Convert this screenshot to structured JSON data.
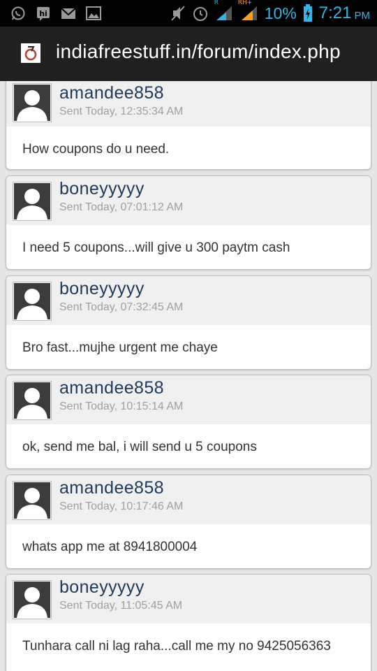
{
  "status_bar": {
    "battery_percent": "10%",
    "time": "7:21",
    "ampm": "PM",
    "signal_labels": {
      "r": "R",
      "rh": "RH+"
    },
    "accent_color": "#33b5e5"
  },
  "browser": {
    "url": "indiafreestuff.in/forum/index.php"
  },
  "messages": [
    {
      "username": "amandee858",
      "sent": "Sent Today, 12:35:34 AM",
      "text": "How coupons do u need."
    },
    {
      "username": "boneyyyyy",
      "sent": "Sent Today, 07:01:12 AM",
      "text": "I need 5 coupons...will give u 300 paytm cash"
    },
    {
      "username": "boneyyyyy",
      "sent": "Sent Today, 07:32:45 AM",
      "text": "Bro fast...mujhe urgent me chaye"
    },
    {
      "username": "amandee858",
      "sent": "Sent Today, 10:15:14 AM",
      "text": "ok, send me bal, i will send u 5 coupons"
    },
    {
      "username": "amandee858",
      "sent": "Sent Today, 10:17:46 AM",
      "text": "whats app me at 8941800004"
    },
    {
      "username": "boneyyyyy",
      "sent": "Sent Today, 11:05:45 AM",
      "text": "Tunhara call ni lag raha...call me my no 9425056363"
    }
  ]
}
